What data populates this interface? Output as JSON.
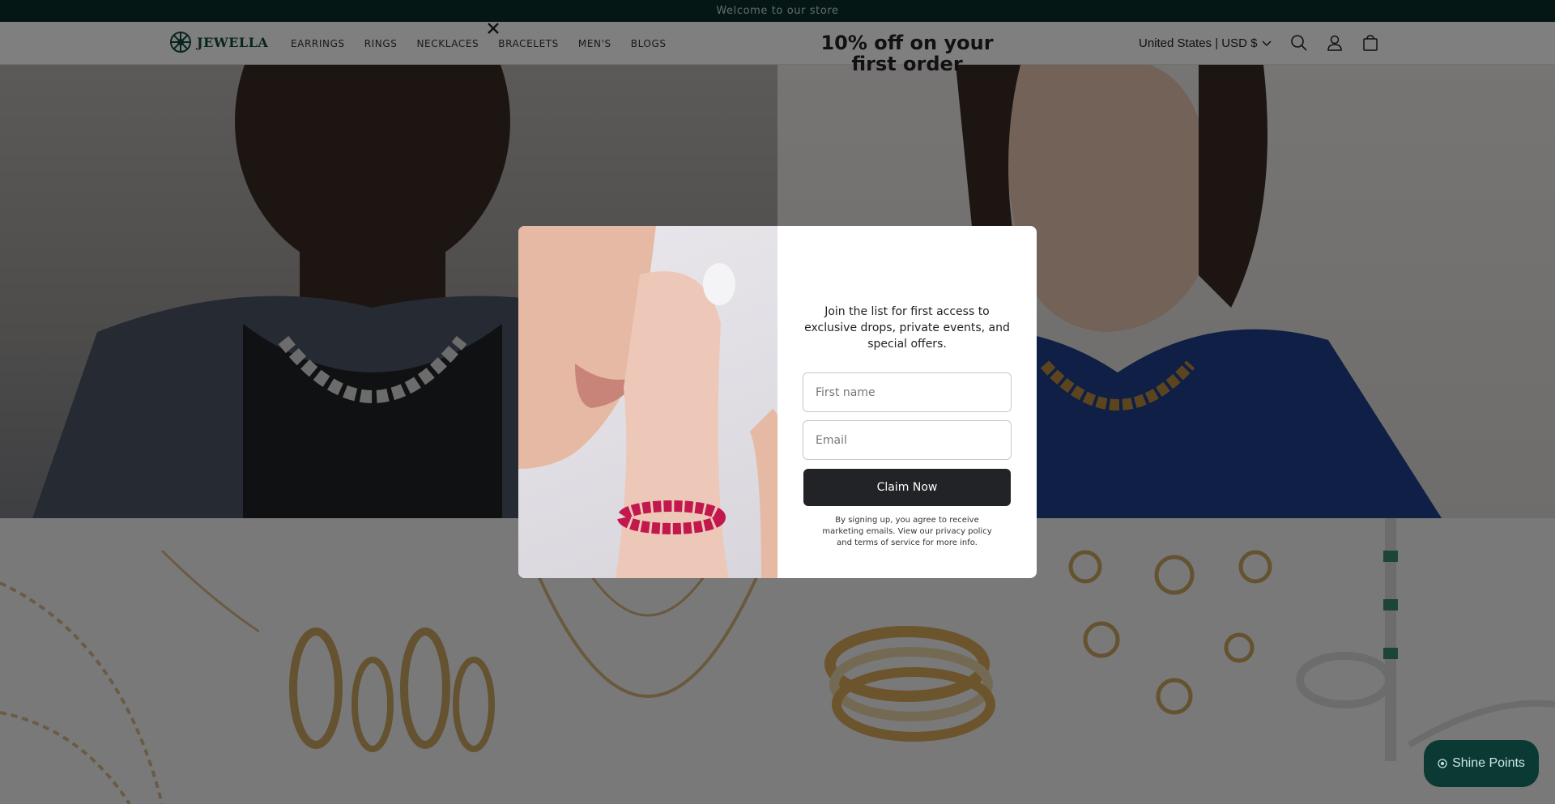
{
  "announcement": {
    "text": "Welcome to our store"
  },
  "header": {
    "brand": "JEWELLA",
    "nav": [
      "EARRINGS",
      "RINGS",
      "NECKLACES",
      "BRACELETS",
      "MEN'S",
      "BLOGS"
    ],
    "locale": "United States | USD $",
    "icons": [
      "search-icon",
      "account-icon",
      "cart-icon"
    ]
  },
  "popup": {
    "title": "10% off on your first order",
    "subtitle": "Join the list for first access to exclusive drops, private events, and special offers.",
    "first_name_placeholder": "First name",
    "email_placeholder": "Email",
    "button": "Claim Now",
    "terms": "By signing up, you agree to receive marketing emails. View our privacy policy and terms of service for more info."
  },
  "widget": {
    "label": "Shine Points"
  },
  "colors": {
    "brand": "#0e4a3f",
    "announcement_bg": "#0a2e2a",
    "button": "#212326"
  }
}
